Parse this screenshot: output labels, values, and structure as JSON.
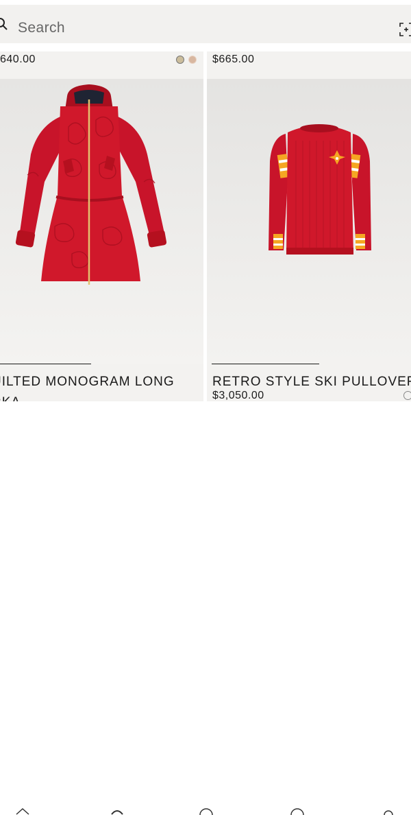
{
  "search": {
    "placeholder": "Search"
  },
  "products": [
    {
      "price": "640.00",
      "title": "UILTED MONOGRAM LONG RKA",
      "swatches": [
        "beige-swatch",
        "rose-swatch"
      ],
      "colors": {
        "main": "#c8142a",
        "dark": "#9e0d1d",
        "zipper": "#e3c16f"
      }
    },
    {
      "price_top": "$665.00",
      "title": "RETRO STYLE SKI PULLOVER",
      "price": "$3,050.00",
      "colors": {
        "main": "#d0182b",
        "dark": "#a80f1f",
        "stripe_orange": "#f5a623",
        "stripe_white": "#ffffff"
      }
    }
  ],
  "icons": {
    "search": "search-icon",
    "scan": "scan-icon",
    "nav": [
      "home-icon",
      "catalog-icon",
      "wishlist-icon",
      "store-icon",
      "account-icon"
    ]
  },
  "colors": {
    "panel_bg": "#f3f2f0",
    "search_bg": "#f2f1ef",
    "text": "#1a1a1a"
  }
}
